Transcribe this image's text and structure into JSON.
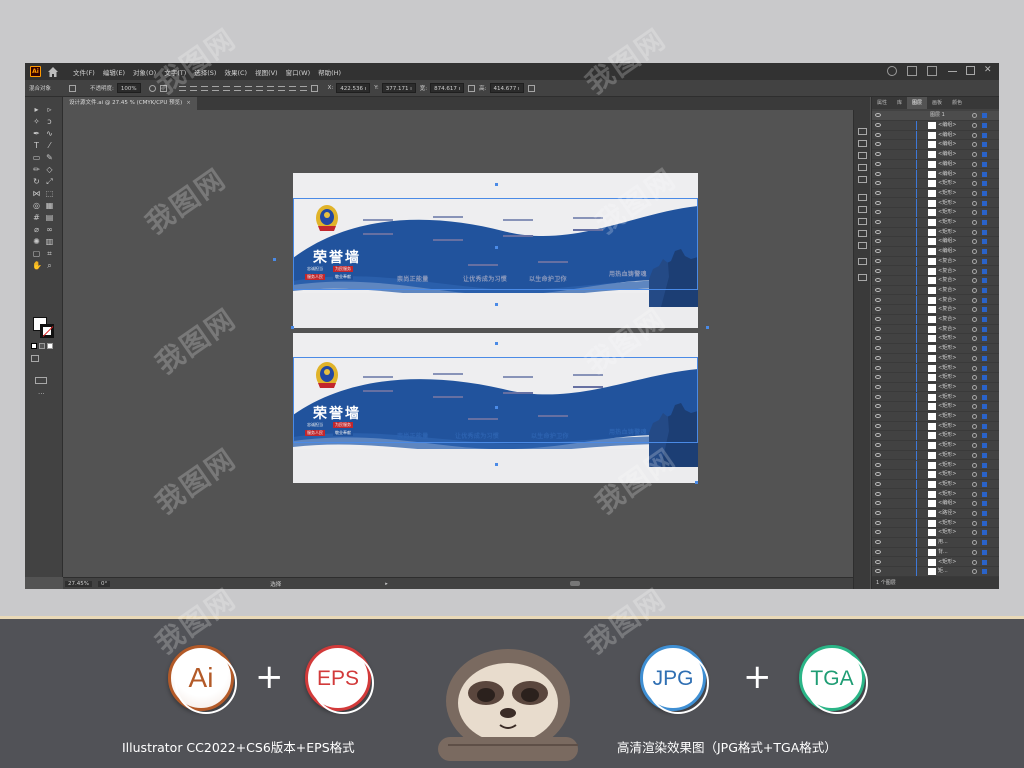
{
  "menubar": {
    "app_logo": "Ai",
    "items": [
      "文件(F)",
      "编辑(E)",
      "对象(O)",
      "文字(T)",
      "选择(S)",
      "效果(C)",
      "视图(V)",
      "窗口(W)",
      "帮助(H)"
    ]
  },
  "controlbar": {
    "object_label": "混合对象",
    "opacity_label": "不透明度:",
    "opacity_value": "100%",
    "x_label": "X:",
    "x_value": "422.536 ı",
    "y_label": "Y:",
    "y_value": "377.171 ı",
    "w_label": "宽:",
    "w_value": "874.617 ı",
    "h_label": "高:",
    "h_value": "414.677 ı"
  },
  "document": {
    "tab_title": "设计源文件.ai @ 27.45 % (CMYK/CPU 预览)",
    "close_glyph": "×"
  },
  "tools": {
    "icons": [
      "selection-tool-icon",
      "direct-selection-tool-icon",
      "magic-wand-icon",
      "lasso-icon",
      "pen-icon",
      "curvature-icon",
      "type-icon",
      "line-icon",
      "rectangle-icon",
      "paintbrush-icon",
      "pencil-icon",
      "eraser-icon",
      "rotate-icon",
      "scale-icon",
      "width-icon",
      "free-transform-icon",
      "shape-builder-icon",
      "perspective-icon",
      "mesh-icon",
      "gradient-icon",
      "eyedropper-icon",
      "blend-icon",
      "symbol-sprayer-icon",
      "column-graph-icon",
      "artboard-icon",
      "slice-icon",
      "hand-icon",
      "zoom-icon"
    ],
    "glyphs": [
      "▸",
      "▹",
      "✧",
      "ↄ",
      "✒",
      "∿",
      "T",
      "⁄",
      "▭",
      "✎",
      "✏",
      "◇",
      "↻",
      "⤢",
      "⋈",
      "⬚",
      "◎",
      "▦",
      "#",
      "▤",
      "⌀",
      "∞",
      "✺",
      "▥",
      "▢",
      "⌗",
      "✋",
      "⌕"
    ],
    "more": "···"
  },
  "artboards": [
    {
      "title": "荣誉墙",
      "subtitles": [
        "忠诚担当",
        "为民服务",
        "服务人民",
        "敬业奉献"
      ],
      "slogans": [
        "崇尚正能量",
        "让优秀成为习惯",
        "以生命护卫你",
        "用热血铸警魂"
      ]
    },
    {
      "title": "荣誉墙",
      "subtitles": [
        "忠诚担当",
        "为民服务",
        "服务人民",
        "敬业奉献"
      ],
      "slogans": [
        "崇尚正能量",
        "让优秀成为习惯",
        "以生命护卫你",
        "用热血铸警魂"
      ]
    }
  ],
  "statusbar": {
    "zoom": "27.45%",
    "rotation": "0°",
    "tool": "选择",
    "arrow": "▸"
  },
  "layers": {
    "tabs": [
      "属性",
      "库",
      "图层",
      "画板",
      "颜色"
    ],
    "active_tab": "图层",
    "top_layer": "图层 1",
    "rows": [
      "<编组>",
      "<编组>",
      "<编组>",
      "<编组>",
      "<编组>",
      "<编组>",
      "<矩形>",
      "<矩形>",
      "<矩形>",
      "<矩形>",
      "<矩形>",
      "<矩形>",
      "<编组>",
      "<编组>",
      "<复合>",
      "<复合>",
      "<复合>",
      "<复合>",
      "<复合>",
      "<复合>",
      "<复合>",
      "<复合>",
      "<矩形>",
      "<矩形>",
      "<矩形>",
      "<矩形>",
      "<矩形>",
      "<矩形>",
      "<矩形>",
      "<矩形>",
      "<矩形>",
      "<矩形>",
      "<矩形>",
      "<矩形>",
      "<矩形>",
      "<矩形>",
      "<矩形>",
      "<矩形>",
      "<矩形>",
      "<编组>",
      "<路径>",
      "<矩形>",
      "<矩形>",
      "用...",
      "背...",
      "<矩形>",
      "矩..."
    ],
    "footer": "1 个图层"
  },
  "promo": {
    "badges": [
      "Ai",
      "EPS",
      "JPG",
      "TGA"
    ],
    "plus": "+",
    "caption_left": "Illustrator CC2022+CS6版本+EPS格式",
    "caption_right": "高清渲染效果图（JPG格式+TGA格式）"
  },
  "watermark": "我图网",
  "colors": {
    "artboard_blue": "#21539d",
    "accent_red": "#c2272d",
    "selection_blue": "#4a8ae6",
    "ai_orange": "#b35a28",
    "eps_red": "#d23a3a",
    "jpg_blue": "#3f8fd3",
    "tga_green": "#2bb587"
  }
}
